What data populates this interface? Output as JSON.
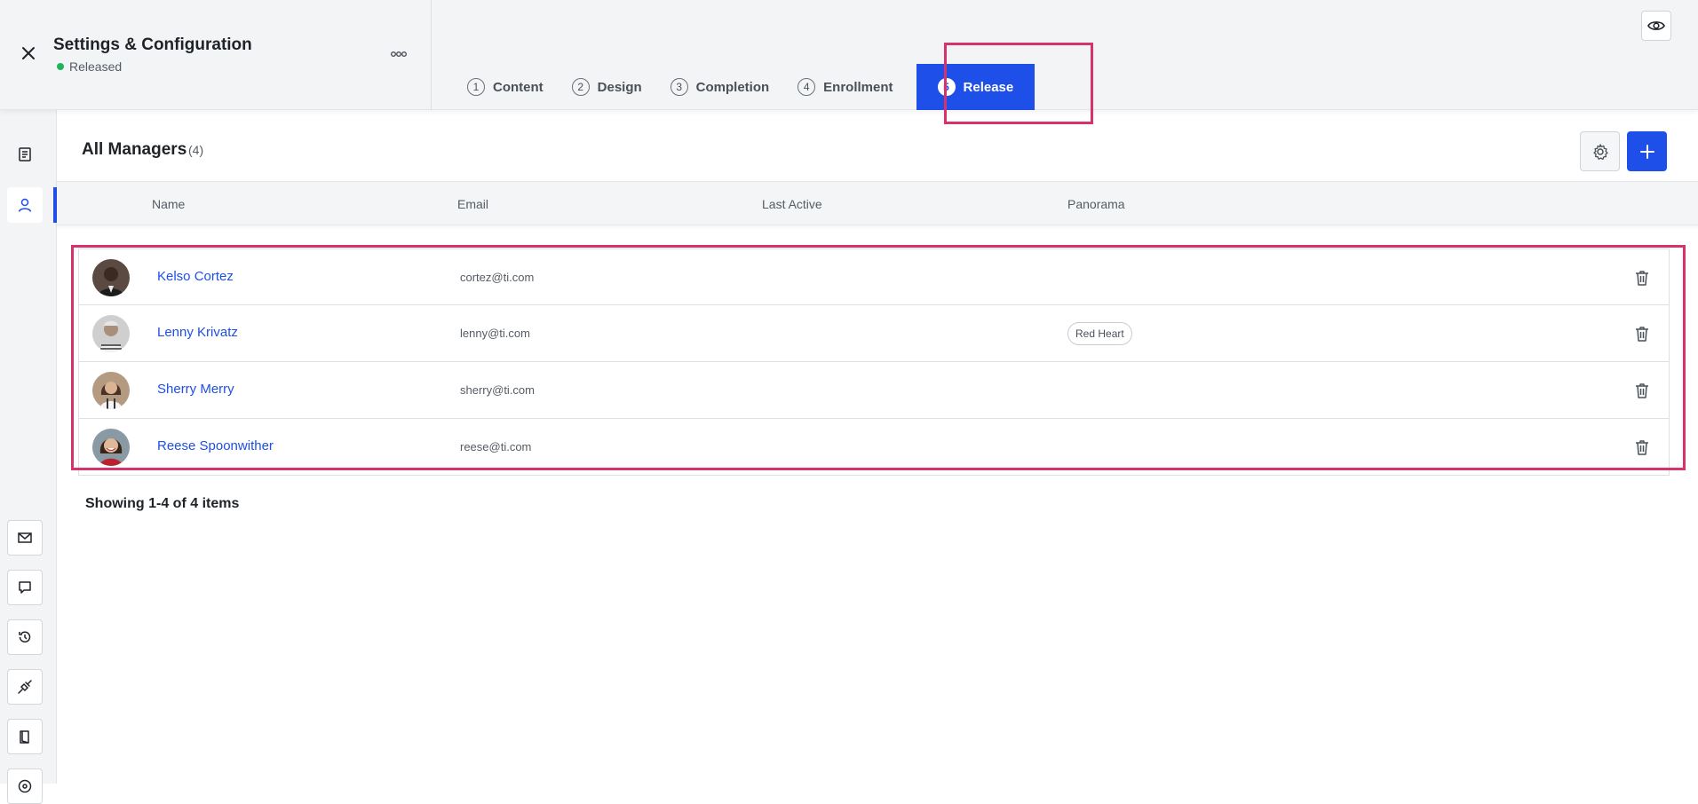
{
  "header": {
    "title": "Settings & Configuration",
    "status": "Released",
    "status_color": "#22b35e",
    "tabs": [
      {
        "num": "1",
        "label": "Content"
      },
      {
        "num": "2",
        "label": "Design"
      },
      {
        "num": "3",
        "label": "Completion"
      },
      {
        "num": "4",
        "label": "Enrollment"
      },
      {
        "num": "5",
        "label": "Release",
        "active": true
      }
    ]
  },
  "sidebar": {
    "items": [
      {
        "icon": "document-list-icon"
      },
      {
        "icon": "user-icon",
        "active": true
      },
      {
        "icon": "mail-icon"
      },
      {
        "icon": "chat-bubble-icon"
      },
      {
        "icon": "history-icon"
      },
      {
        "icon": "plug-icon"
      },
      {
        "icon": "book-icon"
      },
      {
        "icon": "help-icon"
      }
    ]
  },
  "managers": {
    "title": "All Managers",
    "count": "(4)",
    "columns": [
      "Name",
      "Email",
      "Last Active",
      "Panorama"
    ],
    "rows": [
      {
        "name": "Kelso Cortez",
        "email": "cortez@ti.com",
        "last_active": "",
        "panorama": ""
      },
      {
        "name": "Lenny Krivatz",
        "email": "lenny@ti.com",
        "last_active": "",
        "panorama": "Red Heart"
      },
      {
        "name": "Sherry Merry",
        "email": "sherry@ti.com",
        "last_active": "",
        "panorama": ""
      },
      {
        "name": "Reese Spoonwither",
        "email": "reese@ti.com",
        "last_active": "",
        "panorama": ""
      }
    ],
    "footer": "Showing 1-4 of 4 items"
  },
  "colors": {
    "accent": "#1e4fe8",
    "highlight": "#d6336c"
  }
}
